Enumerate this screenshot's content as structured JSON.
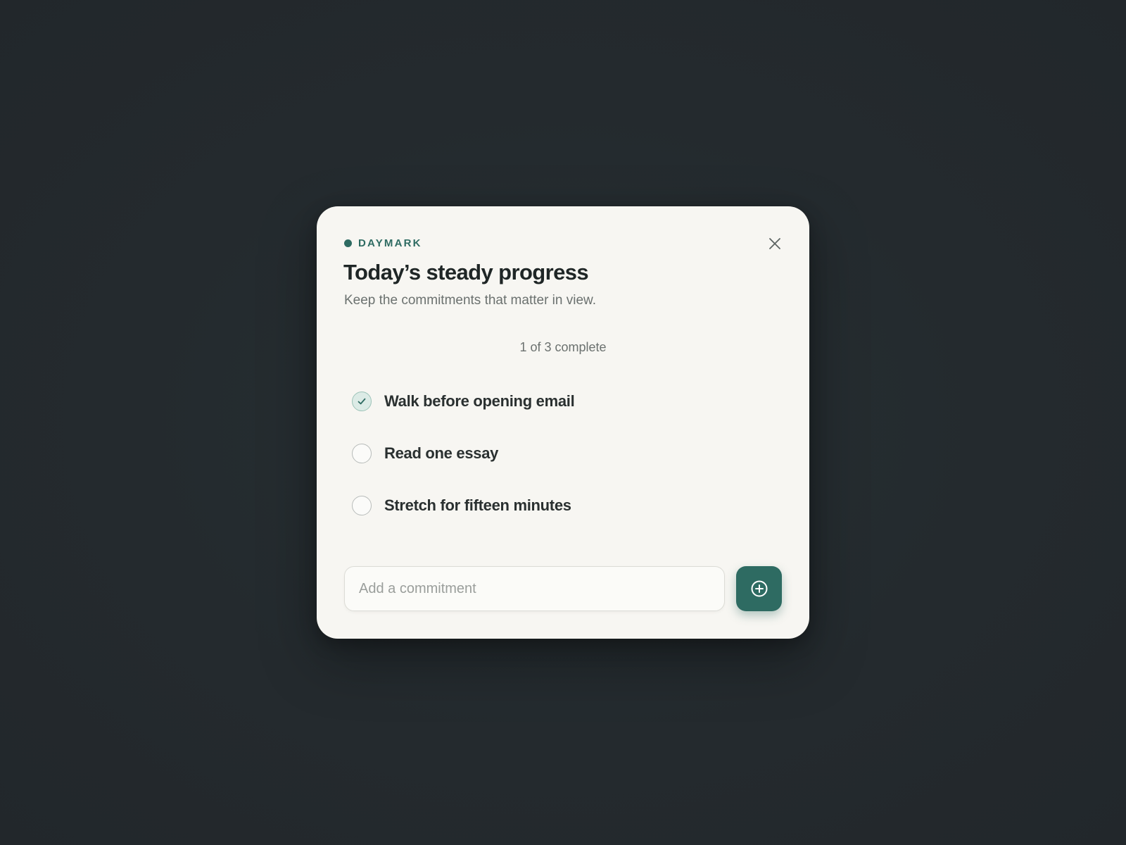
{
  "brand": {
    "name": "DAYMARK",
    "accent_color": "#2e6b62"
  },
  "header": {
    "title": "Today’s steady progress",
    "subtitle": "Keep the commitments that matter in view."
  },
  "progress": {
    "text": "1 of 3 complete",
    "completed": 1,
    "total": 3
  },
  "tasks": [
    {
      "label": "Walk before opening email",
      "done": true
    },
    {
      "label": "Read one essay",
      "done": false
    },
    {
      "label": "Stretch for fifteen minutes",
      "done": false
    }
  ],
  "composer": {
    "placeholder": "Add a commitment",
    "value": "",
    "add_icon": "plus-circle-icon"
  },
  "icons": {
    "close": "close-icon",
    "check": "check-icon"
  }
}
